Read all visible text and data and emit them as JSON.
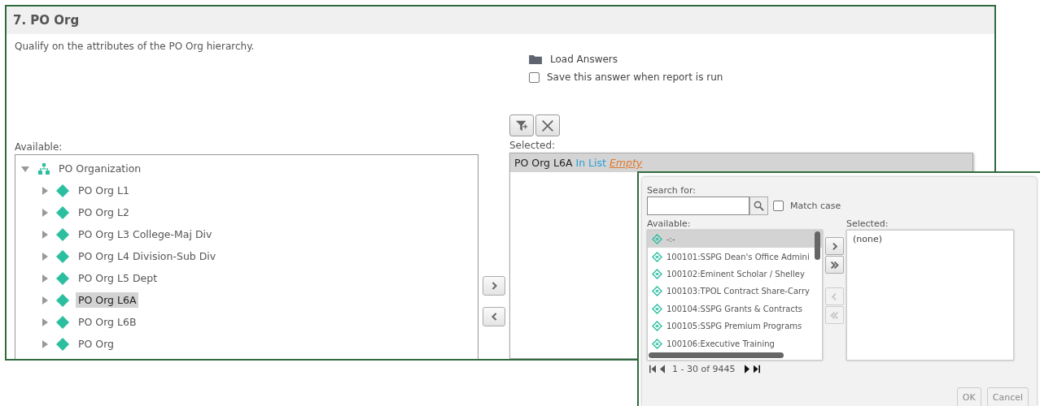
{
  "panel": {
    "title": "7.  PO Org",
    "description": "Qualify on the attributes of the PO Org hierarchy.",
    "load_answers": "Load Answers",
    "save_answer": {
      "label": "Save this answer when report is run",
      "checked": false
    },
    "available_label": "Available:",
    "selected_label": "Selected:",
    "tree": {
      "label": "PO Organization",
      "expanded": true,
      "children": [
        {
          "label": "PO Org L1",
          "expanded": false,
          "selected": false
        },
        {
          "label": "PO Org L2",
          "expanded": false,
          "selected": false
        },
        {
          "label": "PO Org L3 College-Maj Div",
          "expanded": false,
          "selected": false
        },
        {
          "label": "PO Org L4 Division-Sub Div",
          "expanded": false,
          "selected": false
        },
        {
          "label": "PO Org L5 Dept",
          "expanded": false,
          "selected": false
        },
        {
          "label": "PO Org L6A",
          "expanded": false,
          "selected": true
        },
        {
          "label": "PO Org L6B",
          "expanded": false,
          "selected": false
        },
        {
          "label": "PO Org",
          "expanded": false,
          "selected": false
        }
      ]
    },
    "filter": {
      "attribute": "PO Org L6A",
      "operator": "In List",
      "value": "Empty"
    }
  },
  "dialog": {
    "search_label": "Search for:",
    "match_case": {
      "label": "Match case",
      "checked": false
    },
    "available_label": "Available:",
    "selected_label": "Selected:",
    "available": [
      {
        "label": "-:-",
        "selected": true
      },
      {
        "label": "100101:SSPG Dean's Office Admini",
        "selected": false
      },
      {
        "label": "100102:Eminent Scholar / Shelley",
        "selected": false
      },
      {
        "label": "100103:TPOL Contract Share-Carry",
        "selected": false
      },
      {
        "label": "100104:SSPG Grants & Contracts",
        "selected": false
      },
      {
        "label": "100105:SSPG Premium Programs",
        "selected": false
      },
      {
        "label": "100106:Executive Training",
        "selected": false
      }
    ],
    "selected_items": [
      "(none)"
    ],
    "move_buttons": [
      {
        "kind": "add",
        "disabled": false
      },
      {
        "kind": "add-all",
        "disabled": false
      },
      {
        "kind": "remove",
        "disabled": true
      },
      {
        "kind": "remove-all",
        "disabled": true
      }
    ],
    "pager": "1 - 30 of 9445",
    "buttons": [
      "OK",
      "Cancel"
    ]
  }
}
